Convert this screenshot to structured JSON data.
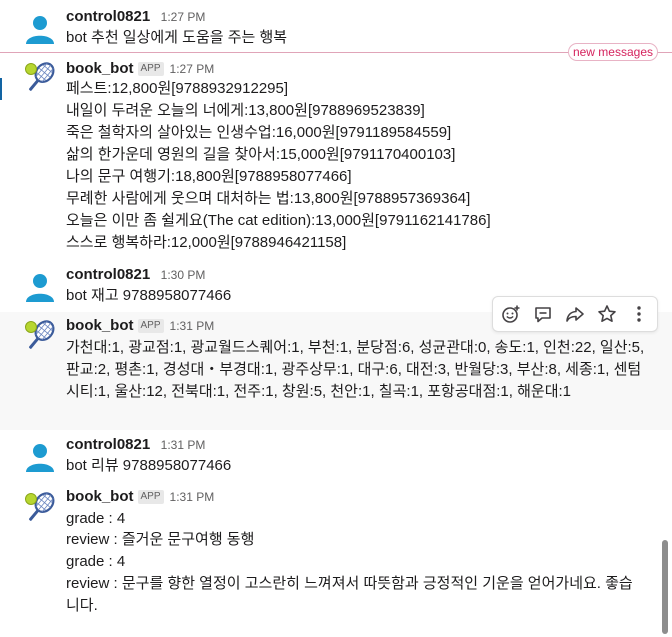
{
  "new_messages_label": "new messages",
  "toolbar_icons": [
    "emoji-reaction-icon",
    "reply-thread-icon",
    "share-icon",
    "star-icon",
    "more-icon"
  ],
  "messages": [
    {
      "name": "control0821",
      "time": "1:27 PM",
      "lines": [
        "bot 추천 일상에게 도움을 주는 행복"
      ]
    },
    {
      "name": "book_bot",
      "badge": "APP",
      "time": "1:27 PM",
      "lines": [
        "페스트:12,800원[9788932912295]",
        "내일이 두려운 오늘의 너에게:13,800원[9788969523839]",
        "죽은 철학자의 살아있는 인생수업:16,000원[9791189584559]",
        "삶의 한가운데 영원의 길을 찾아서:15,000원[9791170400103]",
        "나의 문구 여행기:18,800원[9788958077466]",
        "무례한 사람에게 웃으며 대처하는 법:13,800원[9788957369364]",
        "오늘은 이만 좀 쉴게요(The cat edition):13,000원[9791162141786]",
        "스스로 행복하라:12,000원[9788946421158]"
      ]
    },
    {
      "name": "control0821",
      "time": "1:30 PM",
      "lines": [
        "bot  재고 9788958077466"
      ]
    },
    {
      "name": "book_bot",
      "badge": "APP",
      "time": "1:31 PM",
      "text": "가천대:1, 광교점:1, 광교월드스퀘어:1, 부천:1, 분당점:6, 성균관대:0, 송도:1, 인천:22, 일산:5, 판교:2, 평촌:1, 경성대・부경대:1, 광주상무:1, 대구:6, 대전:3, 반월당:3, 부산:8, 세종:1, 센텀시티:1, 울산:12, 전북대:1, 전주:1, 창원:5, 천안:1, 칠곡:1, 포항공대점:1, 해운대:1"
    },
    {
      "name": "control0821",
      "time": "1:31 PM",
      "lines": [
        "bot 리뷰 9788958077466"
      ]
    },
    {
      "name": "book_bot",
      "badge": "APP",
      "time": "1:31 PM",
      "lines": [
        "grade : 4",
        "review : 즐거운 문구여행 동행",
        "grade : 4"
      ],
      "text": "review : 문구를 향한 열정이 고스란히 느껴져서 따뜻함과 긍정적인 기운을 얻어가네요. 좋습니다."
    }
  ]
}
